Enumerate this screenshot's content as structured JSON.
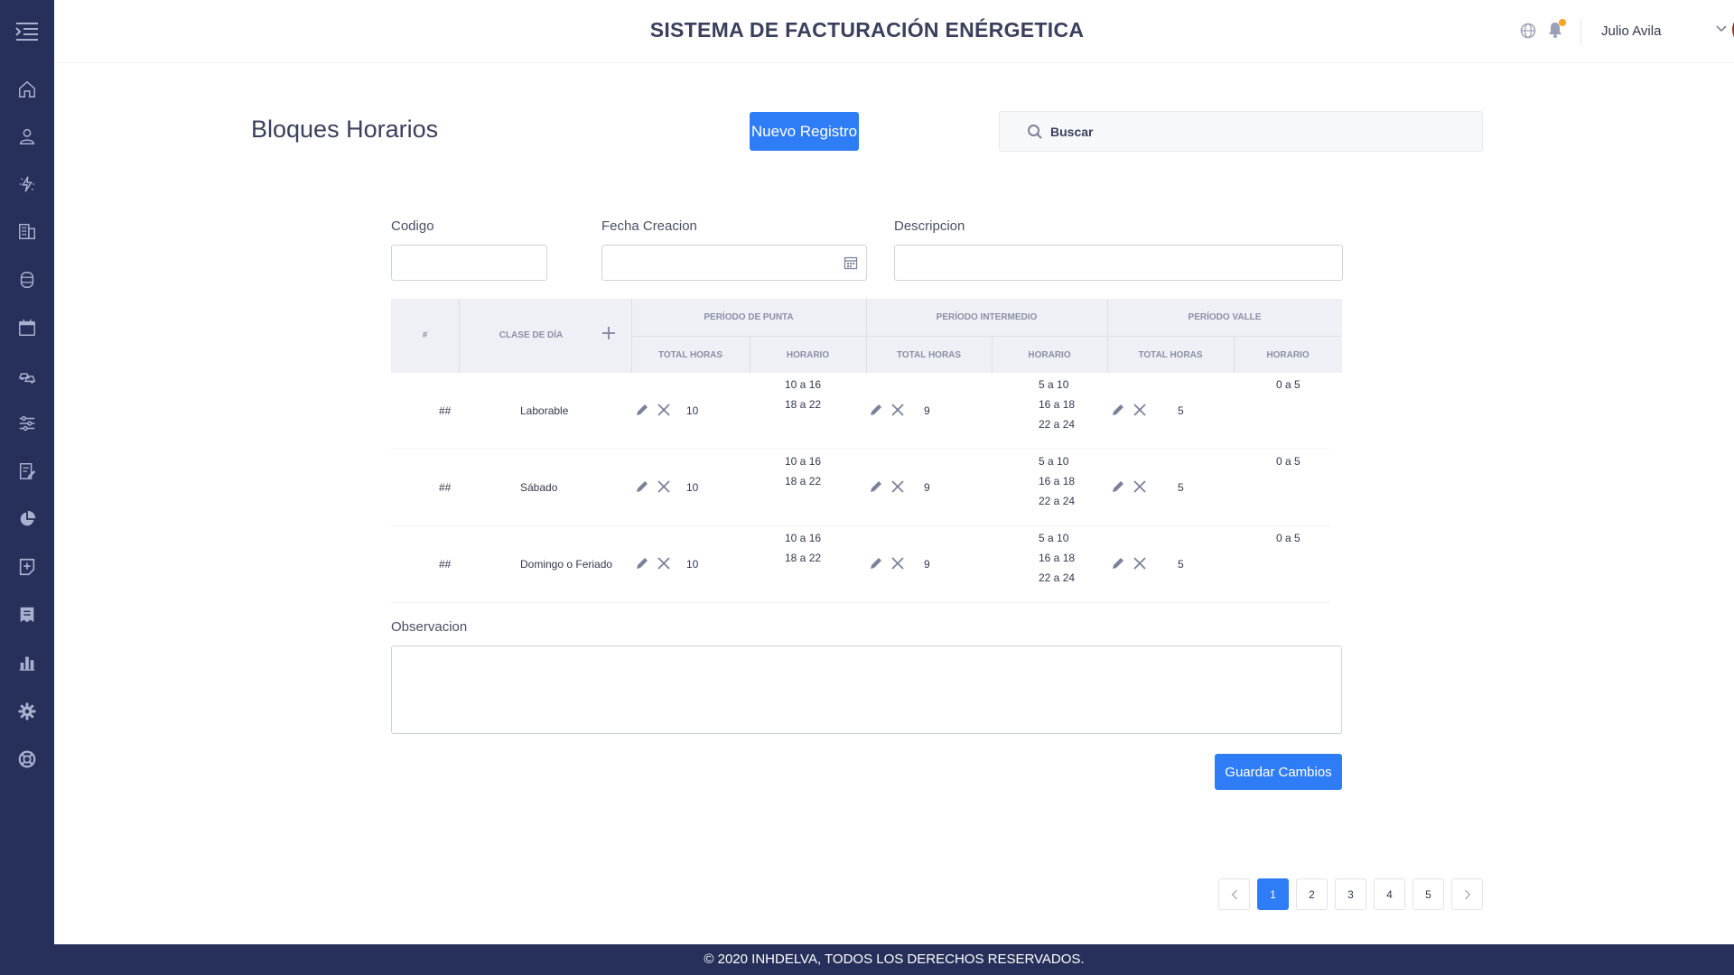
{
  "header": {
    "title": "SISTEMA DE FACTURACIÓN ENÉRGETICA",
    "user_name": "Julio Avila"
  },
  "page": {
    "title": "Bloques Horarios",
    "new_button": "Nuevo Registro",
    "search_placeholder": "Buscar"
  },
  "form": {
    "codigo_label": "Codigo",
    "fecha_label": "Fecha Creacion",
    "descripcion_label": "Descripcion",
    "observacion_label": "Observacion",
    "save_button": "Guardar Cambios"
  },
  "table": {
    "headers": {
      "num": "#",
      "clase": "CLASE DE DÍA",
      "punta": "PERÍODO DE PUNTA",
      "intermedio": "PERÍODO INTERMEDIO",
      "valle": "PERÍODO VALLE",
      "total_horas": "TOTAL HORAS",
      "horario": "HORARIO"
    },
    "rows": [
      {
        "num": "##",
        "clase": "Laborable",
        "punta_total": "10",
        "punta_horario": "10 a 16\n18 a 22",
        "inter_total": "9",
        "inter_horario": "5 a 10\n16 a 18\n22 a 24",
        "valle_total": "5",
        "valle_horario": "0 a 5"
      },
      {
        "num": "##",
        "clase": "Sábado",
        "punta_total": "10",
        "punta_horario": "10 a 16\n18 a 22",
        "inter_total": "9",
        "inter_horario": "5 a 10\n16 a 18\n22 a 24",
        "valle_total": "5",
        "valle_horario": "0 a 5"
      },
      {
        "num": "##",
        "clase": "Domingo o Feriado",
        "punta_total": "10",
        "punta_horario": "10 a 16\n18 a 22",
        "inter_total": "9",
        "inter_horario": "5 a 10\n16 a 18\n22 a 24",
        "valle_total": "5",
        "valle_horario": "0 a 5"
      }
    ]
  },
  "pagination": {
    "pages": [
      "1",
      "2",
      "3",
      "4",
      "5"
    ],
    "current": "1"
  },
  "footer": {
    "text": "© 2020 INHDELVA, TODOS LOS DERECHOS RESERVADOS."
  },
  "colors": {
    "sidebar": "#26305a",
    "primary": "#2f7df6",
    "notification": "#f5a623"
  },
  "sidebar_icons": [
    "home-icon",
    "user-icon",
    "energy-icon",
    "building-icon",
    "meter-icon",
    "calendar-icon",
    "vehicles-icon",
    "sliders-icon",
    "edit-document-icon",
    "pie-chart-icon",
    "add-document-icon",
    "receipt-icon",
    "bar-chart-icon",
    "settings-icon",
    "support-icon"
  ]
}
